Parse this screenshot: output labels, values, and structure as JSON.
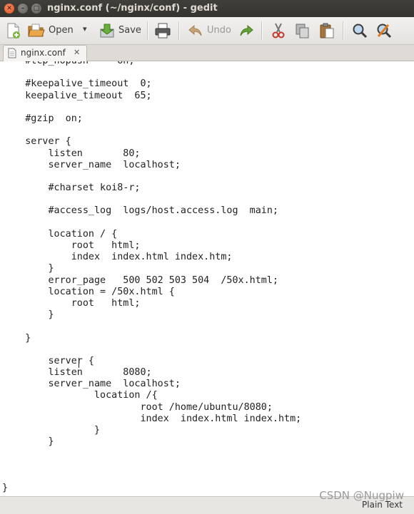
{
  "window": {
    "title": "nginx.conf (~/nginx/conf) - gedit",
    "close_glyph": "✕",
    "minimize_glyph": "–",
    "maximize_glyph": "□"
  },
  "toolbar": {
    "new_icon": "new-document-icon",
    "open_label": "Open",
    "open_icon": "open-folder-icon",
    "open_dropdown_glyph": "▾",
    "save_label": "Save",
    "save_icon": "save-icon",
    "print_icon": "print-icon",
    "undo_label": "Undo",
    "undo_icon": "undo-icon",
    "redo_icon": "redo-icon",
    "cut_icon": "cut-icon",
    "copy_icon": "copy-icon",
    "paste_icon": "paste-icon",
    "find_icon": "find-icon",
    "replace_icon": "find-replace-icon"
  },
  "tab": {
    "label": "nginx.conf",
    "close_glyph": "✕"
  },
  "editor": {
    "lines": [
      "    #tcp_nopush     on;",
      "",
      "    #keepalive_timeout  0;",
      "    keepalive_timeout  65;",
      "",
      "    #gzip  on;",
      "",
      "    server {",
      "        listen       80;",
      "        server_name  localhost;",
      "",
      "        #charset koi8-r;",
      "",
      "        #access_log  logs/host.access.log  main;",
      "",
      "        location / {",
      "            root   html;",
      "            index  index.html index.htm;",
      "        }",
      "        error_page   500 502 503 504  /50x.html;",
      "        location = /50x.html {",
      "            root   html;",
      "        }",
      "",
      "    }",
      "",
      "        server {",
      "        listen       8080;",
      "        server_name  localhost;",
      "                location /{",
      "                        root /home/ubuntu/8080;",
      "                        index  index.html index.htm;",
      "                }",
      "        }",
      "",
      "",
      "",
      "}"
    ]
  },
  "statusbar": {
    "language": "Plain Text"
  },
  "watermark": "CSDN @Nugpiw"
}
